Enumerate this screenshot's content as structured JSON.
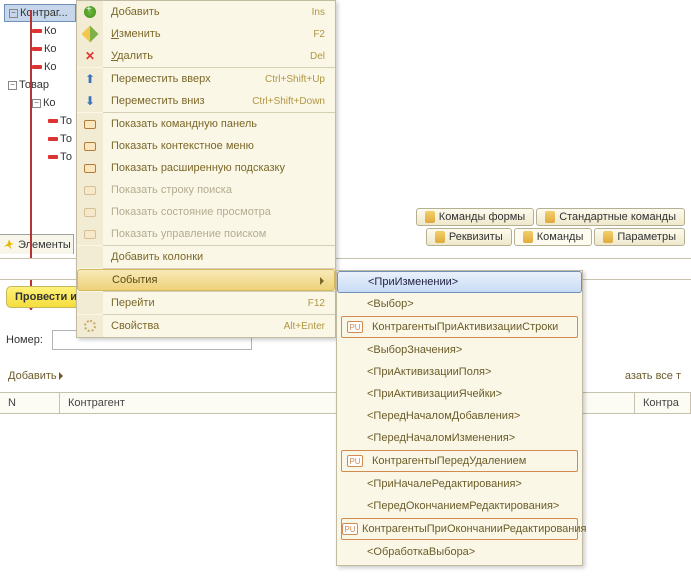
{
  "tree": {
    "root_label": "Контраг...",
    "items": [
      "Ко",
      "Ко",
      "Ко"
    ],
    "second_group": "Товар",
    "sub_group": "Ко",
    "leaves": [
      "То",
      "То",
      "То"
    ]
  },
  "elements_tab": "Элементы",
  "context_menu": {
    "add": {
      "label": "Добавить",
      "shortcut": "Ins"
    },
    "edit": {
      "label": "Изменить",
      "shortcut": "F2"
    },
    "delete": {
      "label": "Удалить",
      "shortcut": "Del"
    },
    "move_up": {
      "label": "Переместить вверх",
      "shortcut": "Ctrl+Shift+Up"
    },
    "move_down": {
      "label": "Переместить вниз",
      "shortcut": "Ctrl+Shift+Down"
    },
    "show_cmd_panel": "Показать командную панель",
    "show_ctx_menu": "Показать контекстное меню",
    "show_ext_tooltip": "Показать расширенную подсказку",
    "show_search": "Показать строку поиска",
    "show_view_state": "Показать состояние просмотра",
    "show_search_ctrl": "Показать управление поиском",
    "add_columns": "Добавить колонки",
    "events": "События",
    "goto": {
      "label": "Перейти",
      "shortcut": "F12"
    },
    "properties": {
      "label": "Свойства",
      "shortcut": "Alt+Enter"
    }
  },
  "events_menu": [
    {
      "label": "<ПриИзменении>",
      "selected": true
    },
    {
      "label": "<Выбор>"
    },
    {
      "label": "КонтрагентыПриАктивизацииСтроки",
      "badge": "PU",
      "highlight": true
    },
    {
      "label": "<ВыборЗначения>"
    },
    {
      "label": "<ПриАктивизацииПоля>"
    },
    {
      "label": "<ПриАктивизацииЯчейки>"
    },
    {
      "label": "<ПередНачаломДобавления>"
    },
    {
      "label": "<ПередНачаломИзменения>"
    },
    {
      "label": "КонтрагентыПередУдалением",
      "badge": "PU",
      "highlight": true
    },
    {
      "label": "<ПриНачалеРедактирования>"
    },
    {
      "label": "<ПередОкончаниемРедактирования>"
    },
    {
      "label": "КонтрагентыПриОкончанииРедактирования",
      "badge": "PU",
      "highlight": true
    },
    {
      "label": "<ОбработкаВыбора>"
    }
  ],
  "right_tabs": {
    "top": [
      "Команды формы",
      "Стандартные команды"
    ],
    "bottom": [
      "Реквизиты",
      "Команды",
      "Параметры"
    ]
  },
  "form": {
    "post_button": "Провести и",
    "nomer_label": "Номер:",
    "add_link": "Добавить",
    "show_all": "азать все т",
    "columns": [
      "N",
      "Контрагент",
      "Контра"
    ]
  }
}
